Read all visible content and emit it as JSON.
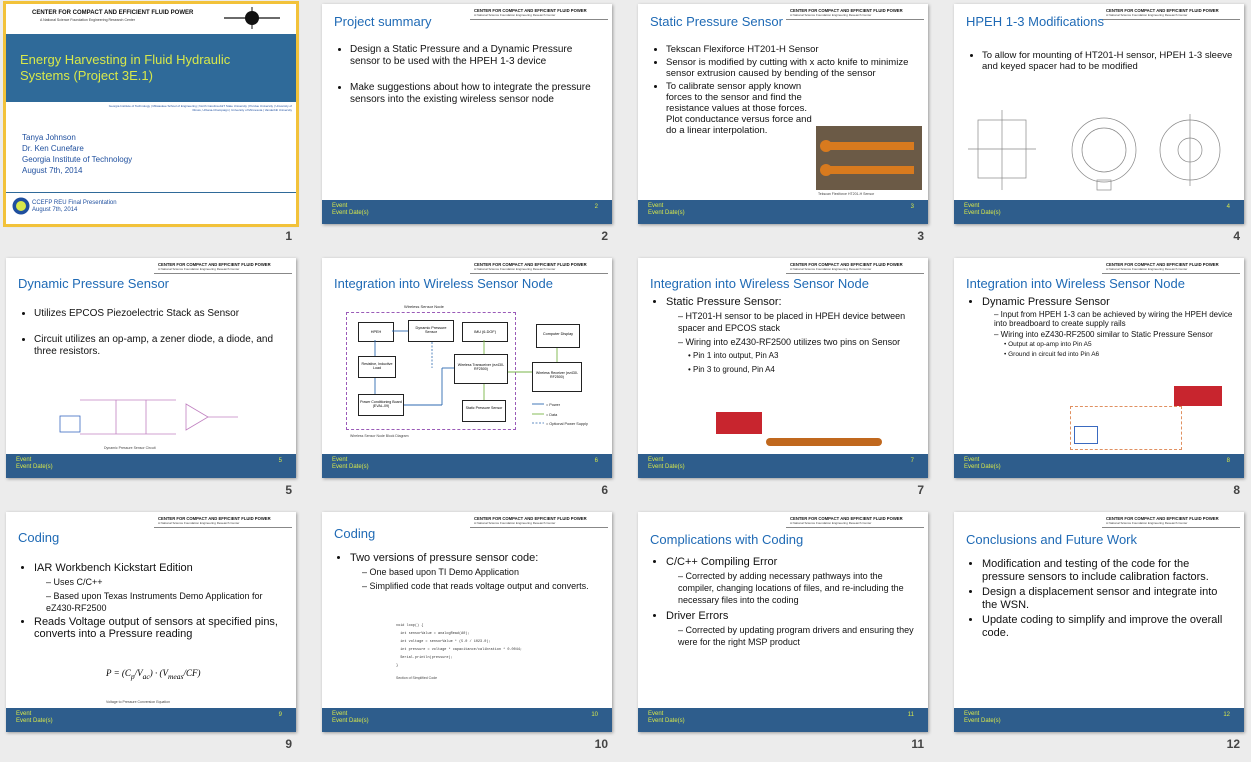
{
  "header": {
    "center_name": "CENTER FOR COMPACT AND EFFICIENT FLUID POWER",
    "center_sub": "A National Science Foundation Engineering Research Center"
  },
  "footer": {
    "event": "Event",
    "event_date": "Event Date(s)"
  },
  "slides": [
    {
      "number": "1",
      "logo_title": "CENTER FOR COMPACT AND EFFICIENT FLUID POWER",
      "logo_sub": "A National Science Foundation Engineering Research Center",
      "title": "Energy Harvesting in Fluid Hydraulic Systems (Project 3E.1)",
      "institutions": "Georgia Institute of Technology | Milwaukee School of Engineering | North Carolina A&T State University | Purdue University | University of Illinois, Urbana-Champaign | University of Minnesota | Vanderbilt University",
      "author1": "Tanya Johnson",
      "author2": "Dr. Ken Cunefare",
      "author3": "Georgia Institute of Technology",
      "author4": "August 7th, 2014",
      "foot1": "CCEFP REU Final Presentation",
      "foot2": "August 7th, 2014"
    },
    {
      "number": "2",
      "page": "2",
      "title": "Project summary",
      "b1": "Design a Static Pressure and a Dynamic Pressure sensor to be used with the HPEH 1-3 device",
      "b2": "Make suggestions about how to integrate the pressure sensors into the existing wireless sensor node"
    },
    {
      "number": "3",
      "page": "3",
      "title": "Static Pressure Sensor",
      "b1": "Tekscan Flexiforce HT201-H Sensor",
      "b2": "Sensor is modified by cutting with x acto knife to minimize sensor extrusion caused by bending of the sensor",
      "b3": "To calibrate sensor apply known forces to the sensor and find the resistance values at those forces. Plot conductance versus force and do a linear interpolation.",
      "caption": "Tekscan Flexiforce HT201-H Sensor"
    },
    {
      "number": "4",
      "page": "4",
      "title": "HPEH 1-3 Modifications",
      "b1": "To allow for mounting of HT201-H sensor, HPEH 1-3 sleeve and keyed spacer had to be modified"
    },
    {
      "number": "5",
      "page": "5",
      "title": "Dynamic Pressure Sensor",
      "b1": "Utilizes EPCOS Piezoelectric Stack as Sensor",
      "b2": "Circuit utilizes an op-amp, a zener diode, a diode, and three resistors.",
      "caption": "Dynamic Pressure Sensor Circuit"
    },
    {
      "number": "6",
      "page": "6",
      "title": "Integration into Wireless Sensor Node",
      "diagram_title": "Wireless Sensor Node",
      "blocks": [
        "HPEH",
        "Dynamic Pressure Sensor",
        "IMU (6-DOF)",
        "Computer Display",
        "Resistive, Inductive Load",
        "Wireless Transceiver (ez430-RF2500)",
        "Wireless Receiver (ez430-RF2500)",
        "Power Conditioning Board (EVAL-09)",
        "Static Pressure Sensor"
      ],
      "legend": [
        "= Power",
        "= Data",
        "= Optional Power Supply"
      ],
      "caption": "Wireless Sensor Node Block Diagram"
    },
    {
      "number": "7",
      "page": "7",
      "title": "Integration into Wireless Sensor Node",
      "b1": "Static Pressure Sensor:",
      "s1": "HT201-H sensor to be placed in HPEH device between spacer and EPCOS stack",
      "s2": "Wiring into eZ430-RF2500 utilizes two pins on Sensor",
      "p1": "Pin 1 into output, Pin A3",
      "p2": "Pin 3 to ground, Pin A4"
    },
    {
      "number": "8",
      "page": "8",
      "title": "Integration into Wireless Sensor Node",
      "b1": "Dynamic Pressure Sensor",
      "s1": "Input from HPEH 1-3 can be achieved by wiring the HPEH device into breadboard to create supply rails",
      "s2": "Wiring into eZ430-RF2500 similar to Static Pressure Sensor",
      "p1": "Output at op-amp into Pin A5",
      "p2": "Ground in circuit fed into Pin A6"
    },
    {
      "number": "9",
      "page": "9",
      "title": "Coding",
      "b1": "IAR Workbench Kickstart Edition",
      "s1": "Uses C/C++",
      "s2": "Based upon Texas Instruments Demo Application for eZ430-RF2500",
      "b2": "Reads Voltage output of sensors at specified pins, converts into a Pressure reading",
      "caption": "Voltage to Pressure Conversion Equation"
    },
    {
      "number": "10",
      "page": "10",
      "title": "Coding",
      "b1": "Two versions of pressure sensor code:",
      "s1": "One based upon TI Demo Application",
      "s2": "Simplified code that reads voltage output and converts.",
      "code": [
        "void loop() {",
        "  int sensorValue = analogRead(A0);",
        "  int voltage = sensorValue * (5.0 / 1023.0);",
        "  int pressure = voltage * capacitance/calibration * 0.0044;",
        "  Serial.println(pressure);",
        "}"
      ],
      "caption": "Section of Simplified Code"
    },
    {
      "number": "11",
      "page": "11",
      "title": "Complications with Coding",
      "b1": "C/C++ Compiling Error",
      "s1": "Corrected by adding necessary pathways into the compiler, changing locations of files, and re-including the necessary files into the coding",
      "b2": "Driver Errors",
      "s2": "Corrected by updating program drivers and ensuring they were for the right MSP product"
    },
    {
      "number": "12",
      "page": "12",
      "title": "Conclusions and Future Work",
      "b1": "Modification and testing of the code for the pressure sensors to include calibration factors.",
      "b2": "Design a displacement sensor and integrate into the WSN.",
      "b3": "Update coding to simplify and improve the overall code."
    }
  ],
  "colors": {
    "accent_title": "#1f6ab5",
    "footer_bar": "#2e5d8c",
    "footer_text": "#d8e84a",
    "selection": "#f2c23a"
  }
}
